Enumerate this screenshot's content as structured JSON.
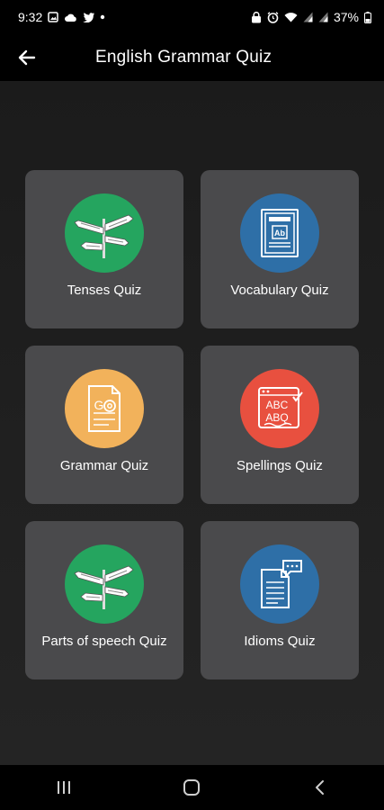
{
  "status_bar": {
    "time": "9:32",
    "battery": "37%"
  },
  "app_bar": {
    "title": "English Grammar Quiz",
    "back_icon": "arrow-left-icon"
  },
  "quizzes": [
    {
      "label": "Tenses Quiz",
      "icon": "signpost-icon",
      "color": "#25a55f"
    },
    {
      "label": "Vocabulary Quiz",
      "icon": "vocabulary-book-icon",
      "color": "#2e6fa7"
    },
    {
      "label": "Grammar Quiz",
      "icon": "grammar-document-icon",
      "color": "#f2b25b"
    },
    {
      "label": "Spellings Quiz",
      "icon": "abc-spelling-icon",
      "color": "#e8503f"
    },
    {
      "label": "Parts of speech Quiz",
      "icon": "signpost-icon",
      "color": "#25a55f"
    },
    {
      "label": "Idioms Quiz",
      "icon": "idioms-document-icon",
      "color": "#2e6fa7"
    }
  ],
  "nav_bar": {
    "icons": [
      "recent-apps-icon",
      "home-icon",
      "back-icon"
    ]
  }
}
